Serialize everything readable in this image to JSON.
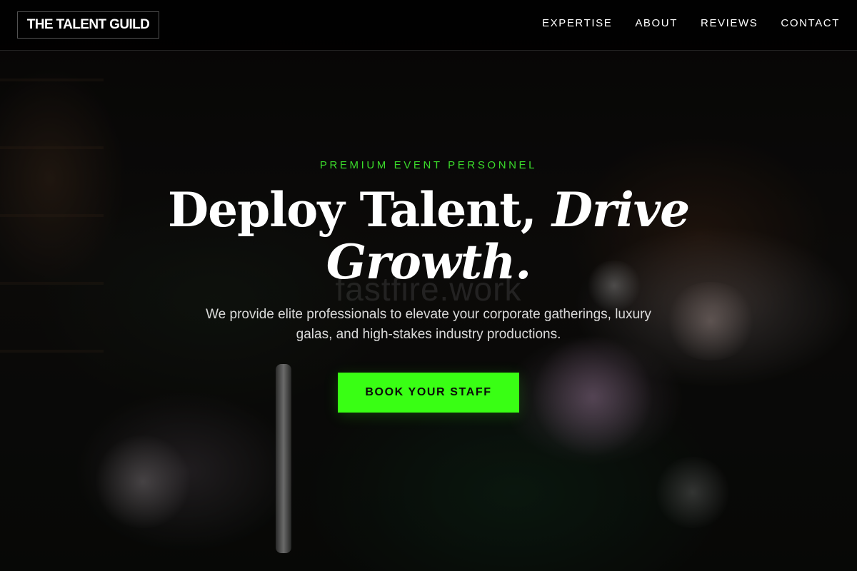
{
  "brand": {
    "name": "THE TALENT GUILD"
  },
  "nav": {
    "items": [
      {
        "label": "EXPERTISE"
      },
      {
        "label": "ABOUT"
      },
      {
        "label": "REVIEWS"
      },
      {
        "label": "CONTACT"
      }
    ]
  },
  "hero": {
    "eyebrow": "PREMIUM EVENT PERSONNEL",
    "headline_regular": "Deploy Talent, ",
    "headline_italic": "Drive Growth.",
    "subtext": "We provide elite professionals to elevate your corporate gatherings, luxury galas, and high-stakes industry productions.",
    "cta_label": "BOOK YOUR STAFF",
    "watermark": "fastfire.work"
  },
  "colors": {
    "accent": "#39ff14",
    "eyebrow": "#3bdc2b",
    "header_background": "#000000",
    "text": "#ffffff"
  },
  "background": {
    "image": "dark-floral-event-photo"
  }
}
